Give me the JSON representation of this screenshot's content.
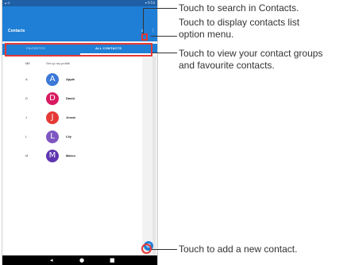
{
  "status": {
    "left": "▴ ⊙",
    "right": "▾ 9:54"
  },
  "app_bar": {
    "title": "Contacts",
    "search_icon": "⌕",
    "menu_icon": "⋮"
  },
  "tabs": {
    "favorites": "FAVORITES",
    "all_contacts": "ALL CONTACTS"
  },
  "contacts": [
    {
      "section": "ME",
      "text": "Set up my profile"
    },
    {
      "section": "A",
      "initial": "A",
      "name": "Apple",
      "color": "#3b78d8"
    },
    {
      "section": "D",
      "initial": "D",
      "name": "David",
      "color": "#d81b60"
    },
    {
      "section": "J",
      "initial": "J",
      "name": "Jessie",
      "color": "#e53935"
    },
    {
      "section": "L",
      "initial": "L",
      "name": "Lily",
      "color": "#7e57c2"
    },
    {
      "section": "M",
      "initial": "M",
      "name": "Marco",
      "color": "#5e35b1"
    }
  ],
  "fab_icon": "⊕",
  "nav": {
    "back": "◂",
    "home": "●",
    "recent": "■"
  },
  "callouts": {
    "search": "Touch to search in Contacts.",
    "options": "Touch to display contacts list\noption menu.",
    "groups": "Touch to view your contact groups\nand favourite contacts.",
    "add": "Touch to add a new contact."
  },
  "colors": {
    "primary": "#1f7fd6",
    "highlight": "#e53935"
  }
}
